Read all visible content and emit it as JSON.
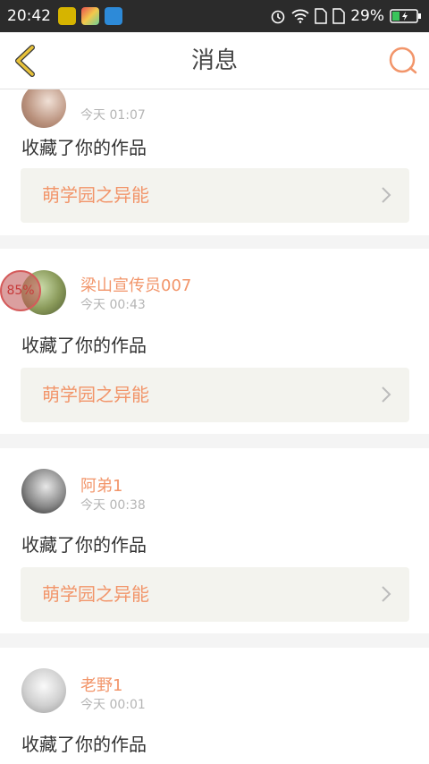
{
  "status_bar": {
    "time": "20:42",
    "battery": "29%",
    "icons": [
      "alarm-icon",
      "wifi-icon",
      "sim1-icon",
      "sim2-icon",
      "battery-icon"
    ]
  },
  "header": {
    "title": "消息",
    "back_icon": "back-chevron-icon",
    "search_icon": "search-icon"
  },
  "messages": [
    {
      "user": "",
      "time": "今天 01:07",
      "action": "收藏了你的作品",
      "work": "萌学园之异能"
    },
    {
      "user": "梁山宣传员007",
      "time": "今天 00:43",
      "action": "收藏了你的作品",
      "work": "萌学园之异能"
    },
    {
      "user": "阿弟1",
      "time": "今天 00:38",
      "action": "收藏了你的作品",
      "work": "萌学园之异能"
    },
    {
      "user": "老野1",
      "time": "今天 00:01",
      "action": "收藏了你的作品",
      "work": ""
    }
  ],
  "overlay_badge": "85%",
  "colors": {
    "accent": "#f2956a",
    "back_icon": "#e8c23a",
    "status_bg": "#2b2b2b"
  }
}
